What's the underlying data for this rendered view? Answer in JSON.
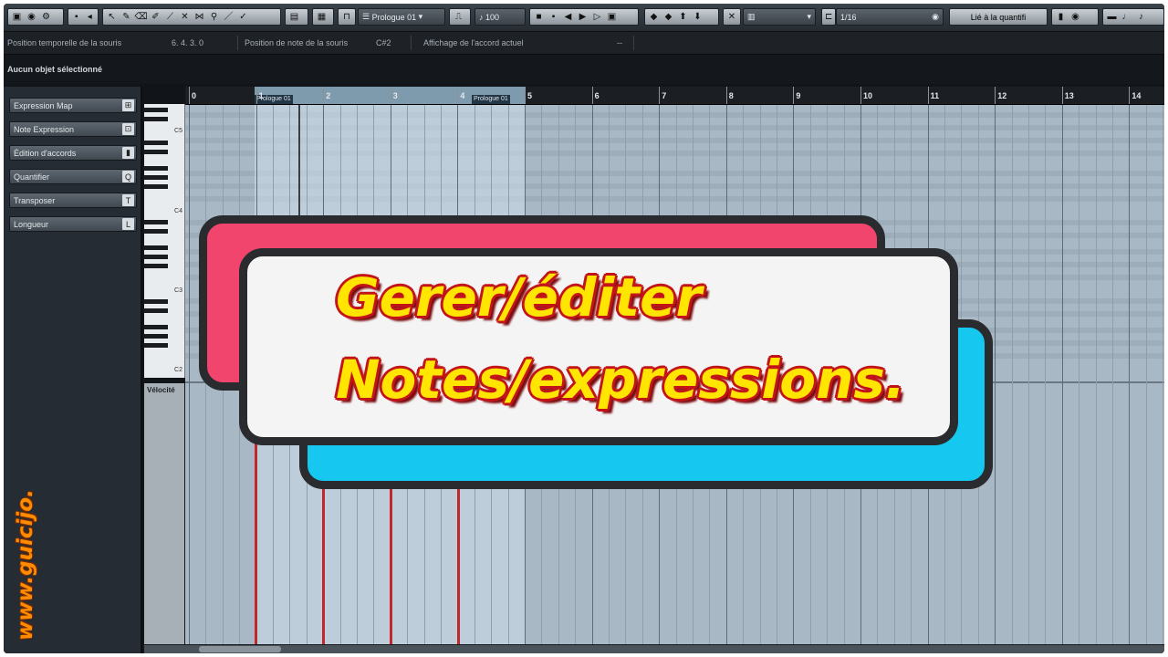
{
  "toolbar": {
    "part_name": "Prologue 01",
    "velocity": "100",
    "quantize": "1/16",
    "length_mode": "Lié à la quantifi"
  },
  "infobar": {
    "mouse_time_label": "Position temporelle de la souris",
    "mouse_time_value": "6. 4. 3.   0",
    "mouse_note_label": "Position de note de la souris",
    "mouse_note_value": "C#2",
    "chord_label": "Affichage de l'accord actuel",
    "chord_value": "--"
  },
  "status": {
    "selection": "Aucun objet sélectionné"
  },
  "inspector": {
    "items": [
      {
        "label": "Expression Map",
        "icon": "expression-map-icon"
      },
      {
        "label": "Note Expression",
        "icon": "note-expression-icon"
      },
      {
        "label": "Édition d'accords",
        "icon": "chord-icon"
      },
      {
        "label": "Quantifier",
        "icon": "quantize-icon"
      },
      {
        "label": "Transposer",
        "icon": "transpose-icon"
      },
      {
        "label": "Longueur",
        "icon": "length-icon"
      }
    ]
  },
  "keyboard": {
    "labels": [
      "C5",
      "C4",
      "C3",
      "C2"
    ]
  },
  "velocity_label": "Vélocité",
  "ruler": {
    "bars": [
      "0",
      "1",
      "2",
      "3",
      "4",
      "5",
      "6",
      "7",
      "8",
      "9",
      "10",
      "11",
      "12",
      "13",
      "14"
    ],
    "part_label_start": "Prologue 01",
    "part_label_end": "Prologue 01"
  },
  "overlay": {
    "line1": "Gerer/éditer",
    "line2": "Notes/expressions."
  },
  "watermark": "www.guicijo.",
  "colors": {
    "pink": "#f1456e",
    "cyan": "#16c8ef",
    "title": "#ffe500",
    "title_outline": "#c3141a",
    "velocity": "#c0282a"
  }
}
